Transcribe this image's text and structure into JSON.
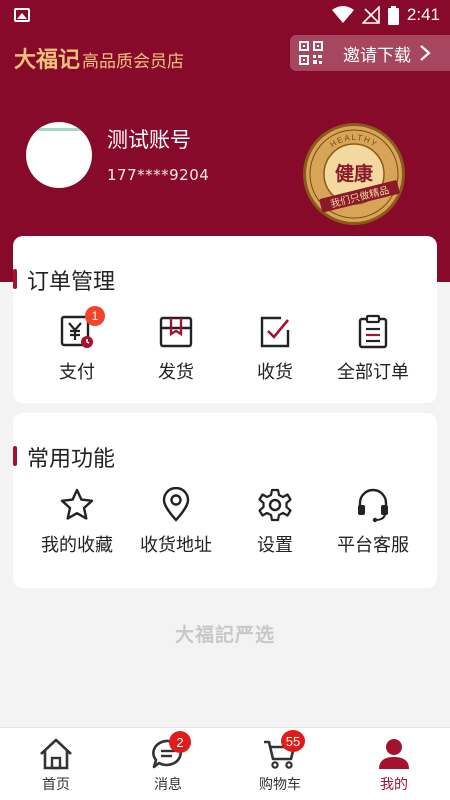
{
  "status_bar": {
    "time": "2:41"
  },
  "header": {
    "logo": "大福记",
    "slogan": "高品质会员店",
    "invite_label": "邀请下载"
  },
  "profile": {
    "username": "测试账号",
    "phone": "177****9204",
    "seal": {
      "top_text": "HEALTHY",
      "main": "健康",
      "bottom": "我们只做精品"
    }
  },
  "orders": {
    "title": "订单管理",
    "items": [
      {
        "label": "支付",
        "icon": "payment-icon",
        "badge": "1"
      },
      {
        "label": "发货",
        "icon": "shipping-box-icon"
      },
      {
        "label": "收货",
        "icon": "receive-check-icon"
      },
      {
        "label": "全部订单",
        "icon": "order-list-icon"
      }
    ]
  },
  "functions": {
    "title": "常用功能",
    "items": [
      {
        "label": "我的收藏",
        "icon": "star-icon"
      },
      {
        "label": "收货地址",
        "icon": "location-pin-icon"
      },
      {
        "label": "设置",
        "icon": "gear-icon"
      },
      {
        "label": "平台客服",
        "icon": "headset-icon"
      }
    ]
  },
  "footer_brand": "大福記严选",
  "tabbar": {
    "items": [
      {
        "label": "首页",
        "icon": "home-icon"
      },
      {
        "label": "消息",
        "icon": "message-icon",
        "badge": "2"
      },
      {
        "label": "购物车",
        "icon": "cart-icon",
        "badge": "55"
      },
      {
        "label": "我的",
        "icon": "user-icon",
        "active": true
      }
    ]
  },
  "colors": {
    "brand": "#880a2a",
    "accent": "#a3122f",
    "gold": "#f1c27b",
    "badge": "#f0452b"
  }
}
